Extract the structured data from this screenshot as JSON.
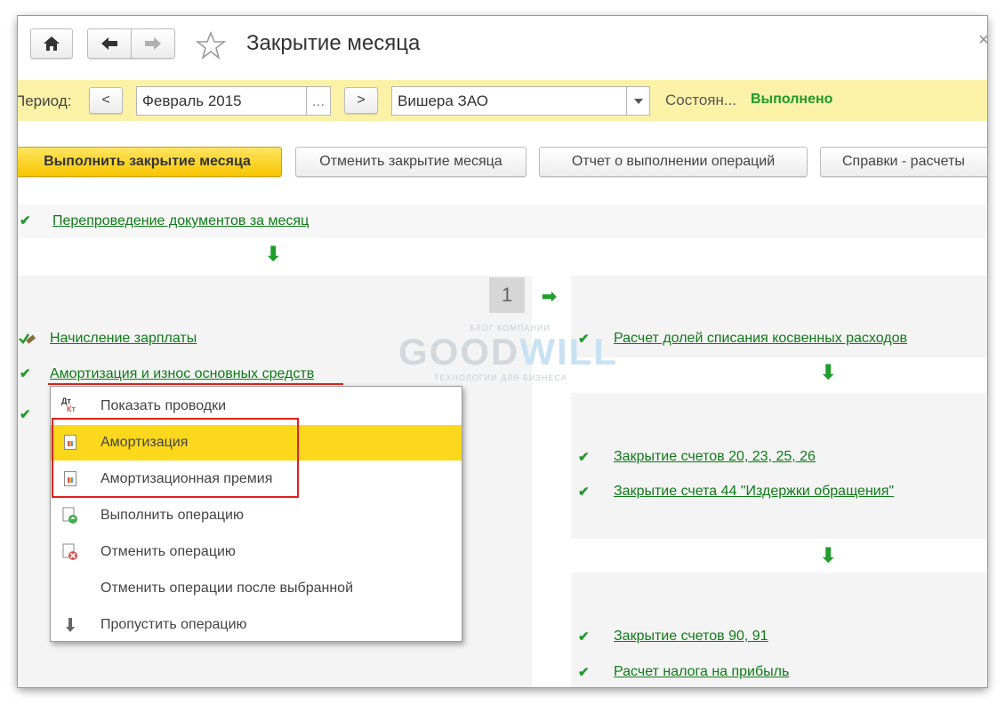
{
  "window": {
    "title": "Закрытие месяца",
    "close_glyph": "×"
  },
  "toolbar": {
    "home_icon": "home-icon",
    "back_icon": "arrow-left-icon",
    "forward_icon": "arrow-right-icon",
    "favorite_icon": "star-icon"
  },
  "filter": {
    "period_label": "Период:",
    "prev_label": "<",
    "period_value": "Февраль 2015",
    "picker_label": "...",
    "next_label": ">",
    "org_value": "Вишера ЗАО",
    "state_label": "Состоян...",
    "state_value": "Выполнено",
    "accent_color": "#fbf2a8",
    "status_color": "#1f9a2b"
  },
  "actions": {
    "run": "Выполнить закрытие месяца",
    "cancel": "Отменить закрытие месяца",
    "report": "Отчет о выполнении операций",
    "help": "Справки - расчеты"
  },
  "steps": {
    "repost": "Перепроведение документов за месяц",
    "stage_number": "1",
    "payroll": "Начисление зарплаты",
    "depreciation": "Амортизация и износ основных средств",
    "indirect": "Расчет долей списания косвенных расходов",
    "close_20": "Закрытие счетов 20, 23, 25, 26",
    "close_44": "Закрытие счета 44 \"Издержки обращения\"",
    "close_90": "Закрытие счетов 90, 91",
    "tax": "Расчет налога на прибыль"
  },
  "watermark": {
    "top": "БЛОГ КОМПАНИИ",
    "main_a": "GOOD",
    "main_b": "WILL",
    "bottom": "ТЕХНОЛОГИИ ДЛЯ БИЗНЕСА"
  },
  "context_menu": {
    "items": [
      {
        "label": "Показать проводки",
        "icon": "dt-kt-icon"
      },
      {
        "label": "Амортизация",
        "icon": "report-icon",
        "selected": true
      },
      {
        "label": "Амортизационная премия",
        "icon": "report-icon"
      },
      {
        "label": "Выполнить операцию",
        "icon": "execute-icon"
      },
      {
        "label": "Отменить операцию",
        "icon": "cancel-operation-icon"
      },
      {
        "label": "Отменить операции после выбранной",
        "icon": ""
      },
      {
        "label": "Пропустить операцию",
        "icon": "arrow-down-icon"
      }
    ],
    "dtkt_top": "Дт",
    "dtkt_bottom": "Кт"
  }
}
